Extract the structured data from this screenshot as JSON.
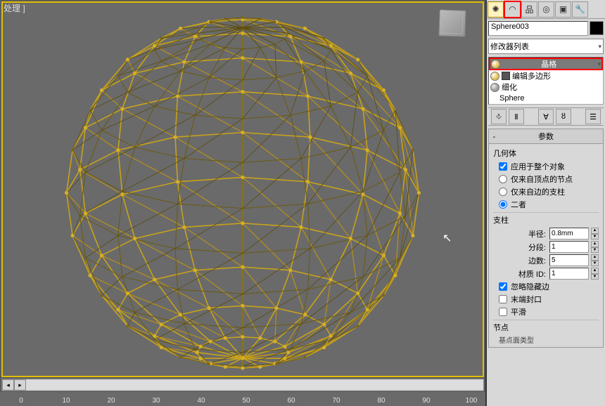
{
  "viewport": {
    "label": "处理 ]"
  },
  "object_name": "Sphere003",
  "modifier_dropdown": "修改器列表",
  "stack": [
    {
      "label": "晶格",
      "selected": true,
      "red": true,
      "bulb": true,
      "icon": "bulb"
    },
    {
      "label": "编辑多边形",
      "bulb": true,
      "icon": "cube"
    },
    {
      "label": "细化",
      "bulb": false,
      "icon": "bulb"
    },
    {
      "label": "Sphere",
      "icon": "none",
      "indent": true
    }
  ],
  "rollout_title": "参数",
  "geometry": {
    "title": "几何体",
    "apply_whole": "应用于整个对象",
    "opt_joints_from_verts": "仅来自顶点的节点",
    "opt_struts_from_edges": "仅来自边的支柱",
    "opt_both": "二者"
  },
  "struts": {
    "title": "支柱",
    "radius_label": "半径:",
    "radius_value": "0.8mm",
    "segments_label": "分段:",
    "segments_value": "1",
    "sides_label": "边数:",
    "sides_value": "5",
    "matid_label": "材质 ID:",
    "matid_value": "1",
    "ignore_hidden": "忽略隐藏边",
    "end_caps": "末端封口",
    "smooth": "平滑"
  },
  "joints": {
    "title": "节点",
    "sub": "基点面类型"
  },
  "ruler_ticks": [
    0,
    10,
    20,
    30,
    40,
    50,
    60,
    70,
    80,
    90,
    100
  ]
}
